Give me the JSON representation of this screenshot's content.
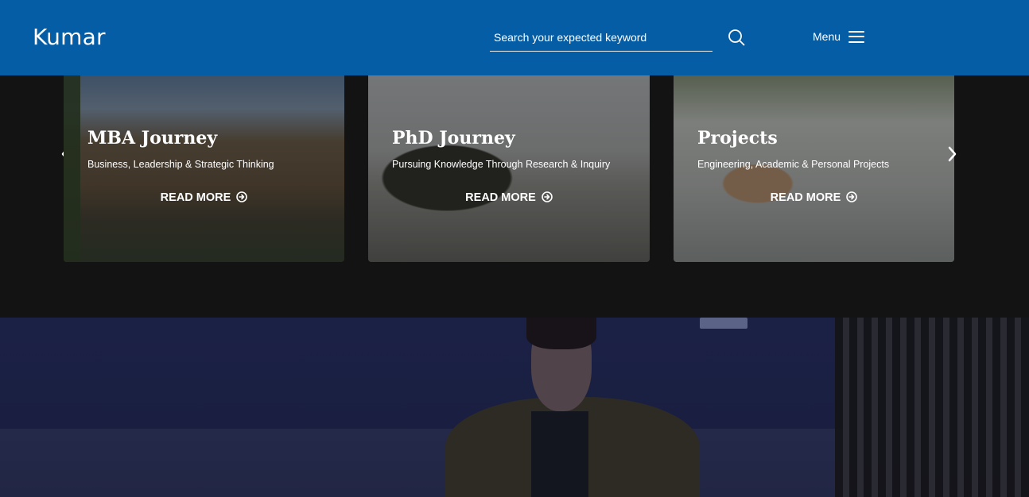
{
  "header": {
    "logo": "Kumar",
    "search_placeholder": "Search your expected keyword",
    "menu_label": "Menu"
  },
  "cards": [
    {
      "title": "MBA Journey",
      "subtitle": "Business, Leadership & Strategic Thinking",
      "cta": "READ MORE"
    },
    {
      "title": "PhD Journey",
      "subtitle": "Pursuing Knowledge Through Research & Inquiry",
      "cta": "READ MORE"
    },
    {
      "title": "Projects",
      "subtitle": "Engineering, Academic & Personal Projects",
      "cta": "READ MORE"
    }
  ],
  "colors": {
    "header_bg": "#055da5",
    "page_bg": "#131313",
    "hero_bg": "#242c5d"
  }
}
